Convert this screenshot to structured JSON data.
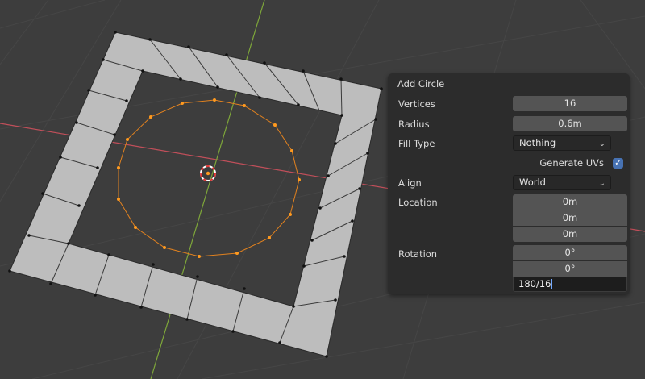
{
  "operator_panel": {
    "title": "Add Circle",
    "vertices": {
      "label": "Vertices",
      "value": "16"
    },
    "radius": {
      "label": "Radius",
      "value": "0.6m"
    },
    "fill_type": {
      "label": "Fill Type",
      "value": "Nothing"
    },
    "generate_uvs": {
      "label": "Generate UVs",
      "checked": true
    },
    "align": {
      "label": "Align",
      "value": "World"
    },
    "location": {
      "label": "Location",
      "x": "0m",
      "y": "0m",
      "z": "0m"
    },
    "rotation": {
      "label": "Rotation",
      "x": "0°",
      "y": "0°",
      "z": "180/16"
    }
  },
  "colors": {
    "viewport_bg": "#3d3d3d",
    "x_axis": "#c14f5a",
    "y_axis": "#7ea73a",
    "selected_edge": "#e2821f",
    "mesh_face": "#bdbdbd",
    "accent": "#4772b3"
  }
}
